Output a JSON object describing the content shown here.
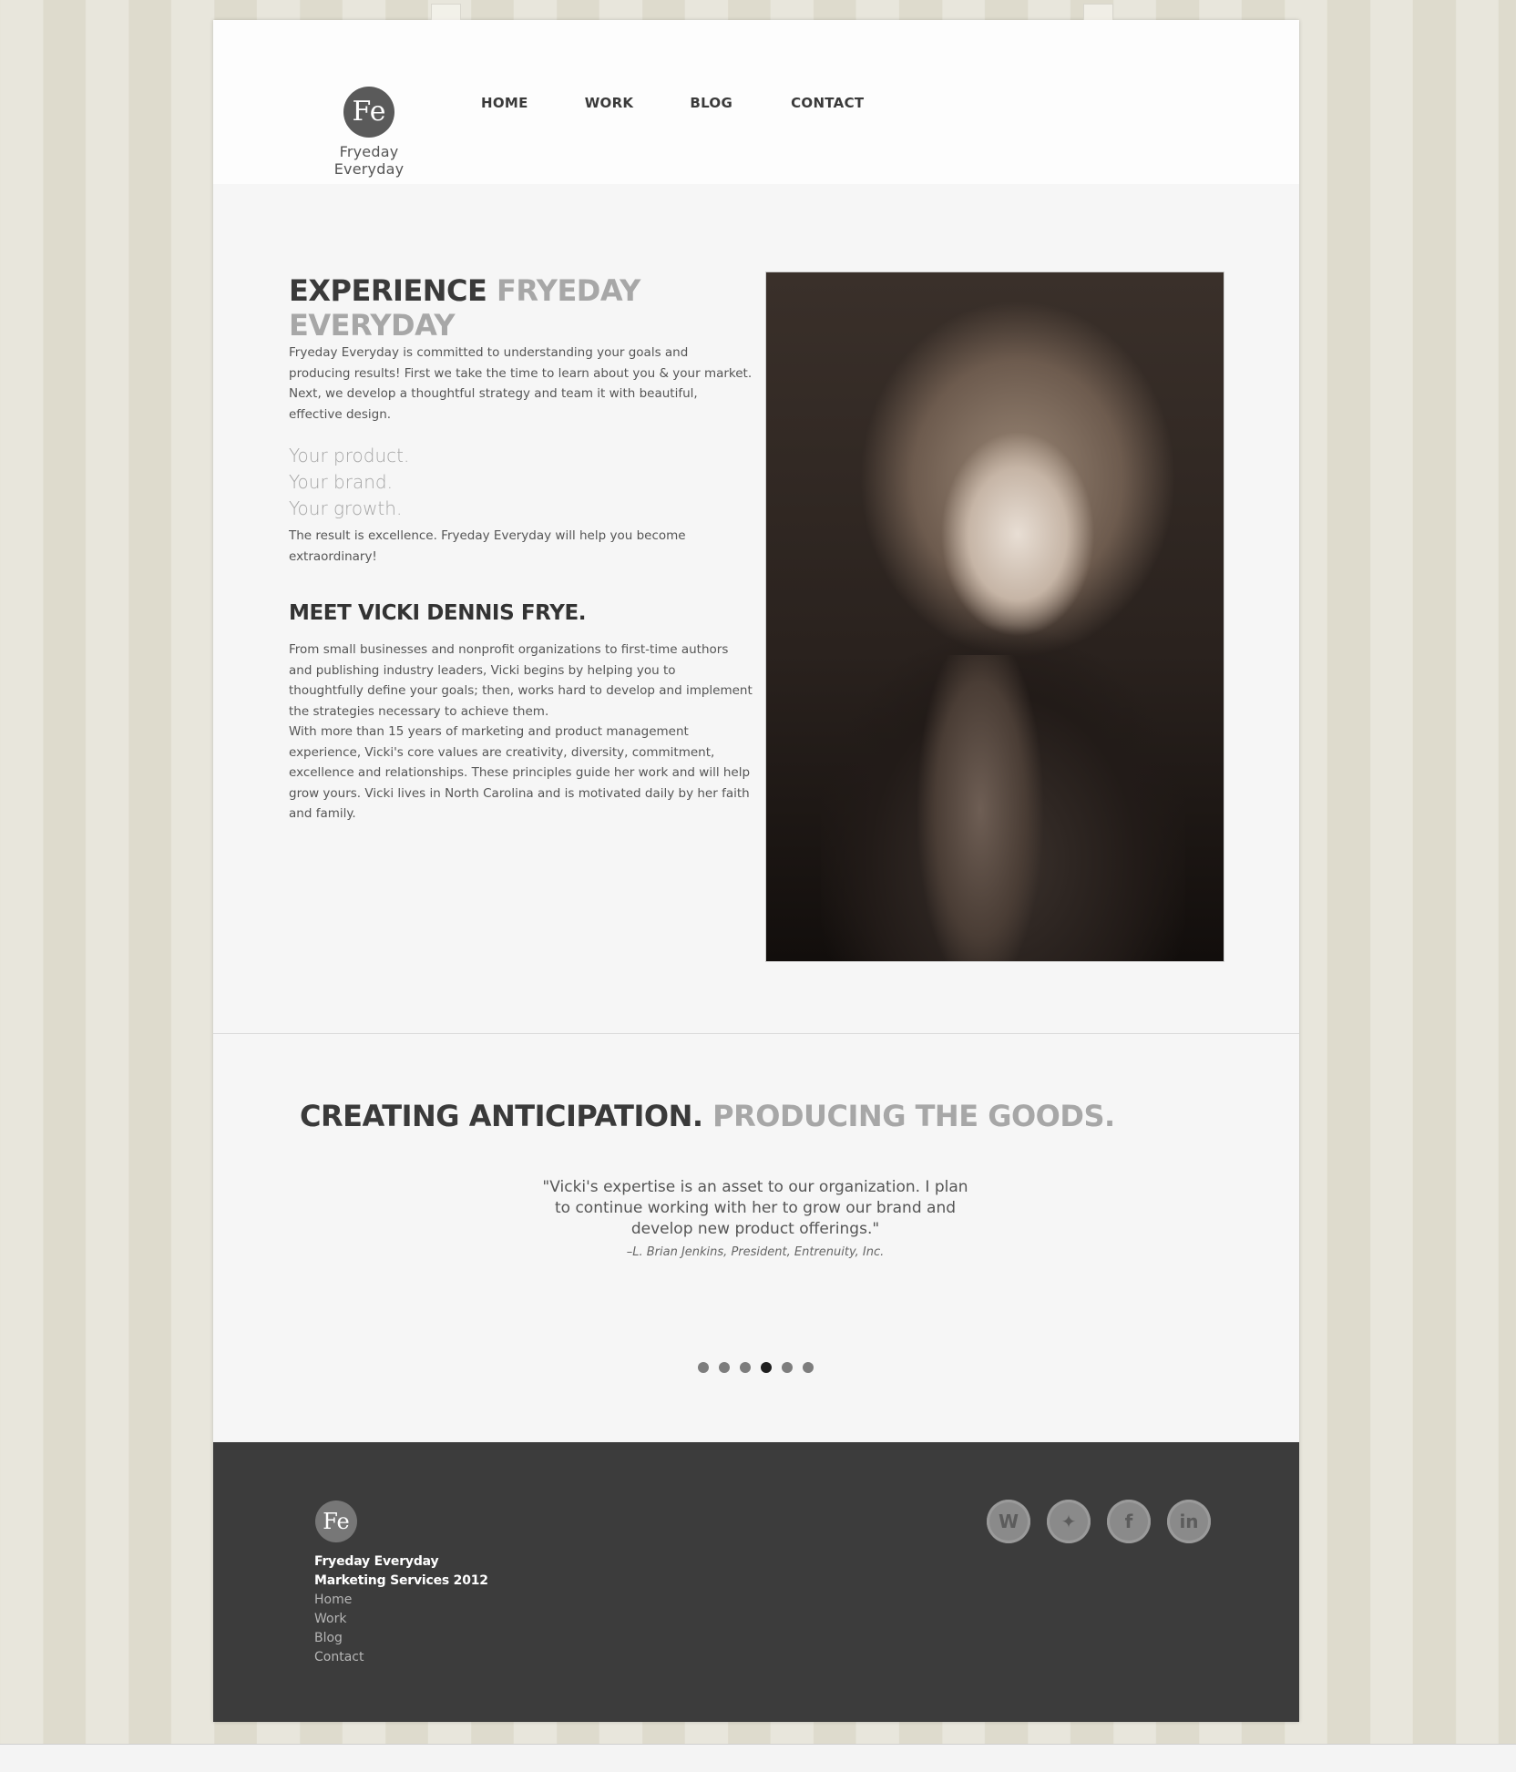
{
  "brand": {
    "name": "Fryeday Everyday",
    "mark": "Fe"
  },
  "nav": {
    "home": "HOME",
    "work": "WORK",
    "blog": "BLOG",
    "contact": "CONTACT"
  },
  "intro": {
    "title_dark": "EXPERIENCE",
    "title_light": "FRYEDAY EVERYDAY",
    "body": "Fryeday Everyday is committed to understanding your goals and producing results! First we take the time to learn about you & your market. Next, we develop a thoughtful strategy and team it with beautiful, effective design.",
    "taglines": [
      "Your product.",
      "Your brand.",
      "Your growth."
    ],
    "result": "The result is excellence. Fryeday Everyday will help you become extraordinary!",
    "meet_title": "MEET VICKI DENNIS FRYE.",
    "meet_p1": "From small businesses and nonprofit organizations to first-time authors and publishing industry leaders, Vicki begins by helping you to thoughtfully define your goals; then, works hard to develop and implement the strategies necessary to achieve them.",
    "meet_p2": "With more than 15 years of marketing and product management experience, Vicki's core values are creativity, diversity, commitment, excellence and relationships. These principles guide her work and will help grow yours. Vicki lives in North Carolina and is motivated daily by her faith and family."
  },
  "testimonials": {
    "title_dark": "CREATING ANTICIPATION.",
    "title_light": "PRODUCING THE GOODS.",
    "quote": "\"Vicki's expertise is an asset to our organization. I plan to continue working with her to grow our brand and develop new product offerings.\"",
    "attribution": "–L. Brian Jenkins, President, Entrenuity, Inc.",
    "slide_count": 6,
    "active_slide": 4
  },
  "footer": {
    "brand_line1": "Fryeday Everyday",
    "brand_line2": "Marketing Services 2012",
    "links": [
      "Home",
      "Work",
      "Blog",
      "Contact"
    ],
    "social": [
      "wordpress-icon",
      "twitter-icon",
      "facebook-icon",
      "linkedin-icon"
    ],
    "social_glyphs": [
      "W",
      "✦",
      "f",
      "in"
    ]
  }
}
